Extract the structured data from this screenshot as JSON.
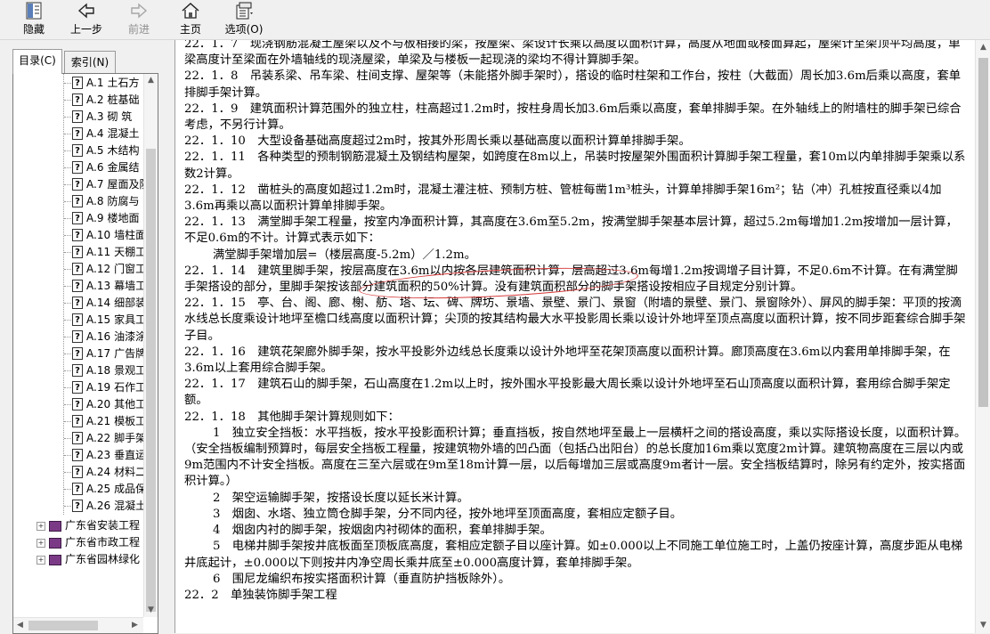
{
  "toolbar": {
    "hide": "隐藏",
    "back": "上一步",
    "forward": "前进",
    "home": "主页",
    "options": "选项(O)"
  },
  "tabs": {
    "contents": "目录(C)",
    "index": "索引(N)"
  },
  "tree": {
    "items": [
      {
        "code": "A.1",
        "label": "土石方"
      },
      {
        "code": "A.2",
        "label": "桩基础"
      },
      {
        "code": "A.3",
        "label": "砌  筑"
      },
      {
        "code": "A.4",
        "label": "混凝土"
      },
      {
        "code": "A.5",
        "label": "木结构"
      },
      {
        "code": "A.6",
        "label": "金属结"
      },
      {
        "code": "A.7",
        "label": "屋面及防"
      },
      {
        "code": "A.8",
        "label": "防腐与"
      },
      {
        "code": "A.9",
        "label": "楼地面"
      },
      {
        "code": "A.10",
        "label": "墙柱面"
      },
      {
        "code": "A.11",
        "label": "天棚工"
      },
      {
        "code": "A.12",
        "label": "门窗工"
      },
      {
        "code": "A.13",
        "label": "幕墙工"
      },
      {
        "code": "A.14",
        "label": "细部装"
      },
      {
        "code": "A.15",
        "label": "家具工"
      },
      {
        "code": "A.16",
        "label": "油漆涂"
      },
      {
        "code": "A.17",
        "label": "广告牌"
      },
      {
        "code": "A.18",
        "label": "景观工"
      },
      {
        "code": "A.19",
        "label": "石作工"
      },
      {
        "code": "A.20",
        "label": "其他工"
      },
      {
        "code": "A.21",
        "label": "模板工"
      },
      {
        "code": "A.22",
        "label": "脚手架"
      },
      {
        "code": "A.23",
        "label": "垂直运"
      },
      {
        "code": "A.24",
        "label": "材料二"
      },
      {
        "code": "A.25",
        "label": "成品保"
      },
      {
        "code": "A.26",
        "label": "混凝土"
      }
    ],
    "books": [
      {
        "label": "广东省安装工程"
      },
      {
        "label": "广东省市政工程"
      },
      {
        "label": "广东省园林绿化"
      }
    ]
  },
  "content": {
    "paragraphs": [
      {
        "text": "22．1．7　现浇钢筋混凝土屋架以及不与板相接的梁，按屋架、梁设计长乘以高度以面积计算，高度从地面或楼面算起，屋架计至架顶平均高度，单梁高度计至梁面在外墙轴线的现浇屋梁，单梁及与楼板一起现浇的梁均不得计算脚手架。",
        "style": ""
      },
      {
        "text": "22．1．8　吊装系梁、吊车梁、柱间支撑、屋架等（未能搭外脚手架时），搭设的临时柱架和工作台，按柱（大截面）周长加3.6m后乘以高度，套单排脚手架计算。",
        "style": ""
      },
      {
        "text": "22．1．9　建筑面积计算范围外的独立柱，柱高超过1.2m时，按柱身周长加3.6m后乘以高度，套单排脚手架。在外轴线上的附墙柱的脚手架已综合考虑，不另行计算。",
        "style": ""
      },
      {
        "text": "22．1．10　大型设备基础高度超过2m时，按其外形周长乘以基础高度以面积计算单排脚手架。",
        "style": ""
      },
      {
        "text": "22．1．11　各种类型的预制钢筋混凝土及钢结构屋架，如跨度在8m以上，吊装时按屋架外围面积计算脚手架工程量，套10m以内单排脚手架乘以系数2计算。",
        "style": ""
      },
      {
        "text": "22．1．12　凿桩头的高度如超过1.2m时，混凝土灌注桩、预制方桩、管桩每凿1m³桩头，计算单排脚手架16m²；钻（冲）孔桩按直径乘以4加3.6m再乘以高以面积计算单排脚手架。",
        "style": ""
      },
      {
        "text": "22．1．13　满堂脚手架工程量，按室内净面积计算，其高度在3.6m至5.2m，按满堂脚手架基本层计算，超过5.2m每增加1.2m按增加一层计算，不足0.6m的不计。计算式表示如下：",
        "style": ""
      },
      {
        "text": "满堂脚手架增加层=（楼层高度-5.2m）／1.2m。",
        "style": "ind"
      },
      {
        "text": "22．1．14　建筑里脚手架，按层高度在3.6m以内按各层建筑面积计算，层高超过3.6m每增1.2m按调增子目计算，不足0.6m不计算。在有满堂脚手架搭设的部分，里脚手架按该部分建筑面积的50%计算。没有建筑面积部分的脚手架搭设按相应子目规定分别计算。",
        "style": ""
      },
      {
        "text": "22．1．15　亭、台、阁、廊、榭、舫、塔、坛、碑、牌坊、景墙、景壁、景门、景窗（附墙的景壁、景门、景窗除外）、屏风的脚手架：平顶的按滴水线总长度乘设计地坪至檐口线高度以面积计算；尖顶的按其结构最大水平投影周长乘以设计外地坪至顶点高度以面积计算，按不同步距套综合脚手架子目。",
        "style": ""
      },
      {
        "text": "22．1．16　建筑花架廊外脚手架，按水平投影外边线总长度乘以设计外地坪至花架顶高度以面积计算。廊顶高度在3.6m以内套用单排脚手架，在3.6m以上套用综合脚手架。",
        "style": ""
      },
      {
        "text": "22．1．17　建筑石山的脚手架，石山高度在1.2m以上时，按外围水平投影最大周长乘以设计外地坪至石山顶高度以面积计算，套用综合脚手架定额。",
        "style": ""
      },
      {
        "text": "22．1．18　其他脚手架计算规则如下：",
        "style": ""
      },
      {
        "text": "1　独立安全挡板：水平挡板，按水平投影面积计算；垂直挡板，按自然地坪至最上一层横杆之间的搭设高度，乘以实际搭设长度，以面积计算。（安全挡板编制预算时，每层安全挡板工程量，按建筑物外墙的凹凸面（包括凸出阳台）的总长度加16m乘以宽度2m计算。建筑物高度在三层以内或9m范围内不计安全挡板。高度在三至六层或在9m至18m计算一层，以后每增加三层或高度9m者计一层。安全挡板结算时，除另有约定外，按实搭面积计算。）",
        "style": "ind2"
      },
      {
        "text": "2　架空运输脚手架，按搭设长度以延长米计算。",
        "style": "ind2"
      },
      {
        "text": "3　烟囱、水塔、独立筒仓脚手架，分不同内径，按外地坪至顶面高度，套相应定额子目。",
        "style": "ind2"
      },
      {
        "text": "4　烟囱内衬的脚手架，按烟囱内衬砌体的面积，套单排脚手架。",
        "style": "ind2"
      },
      {
        "text": "5　电梯井脚手架按井底板面至顶板底高度，套相应定额子目以座计算。如±0.000以上不同施工单位施工时，上盖仍按座计算，高度步距从电梯井底起计，±0.000以下则按井内净空周长乘井底至±0.000高度计算，套单排脚手架。",
        "style": "ind2"
      },
      {
        "text": "6　围尼龙编织布按实搭面积计算（垂直防护挡板除外）。",
        "style": "ind2"
      },
      {
        "text": "22．2　单独装饰脚手架工程",
        "style": ""
      }
    ]
  }
}
